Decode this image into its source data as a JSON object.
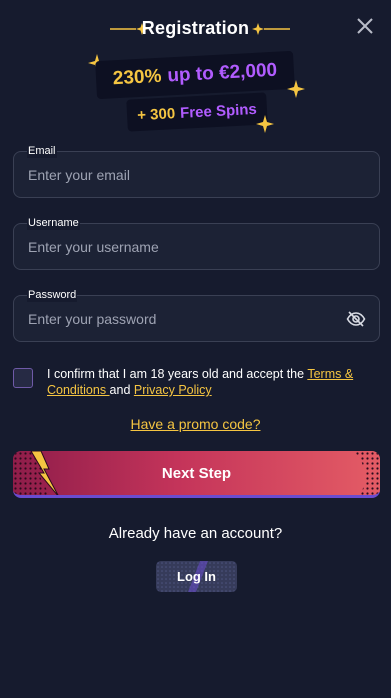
{
  "header": {
    "title": "Registration",
    "close_icon": "close-icon"
  },
  "promo": {
    "main_percent": "230%",
    "main_rest": "up to €2,000",
    "sub_count": "+ 300",
    "sub_rest": "Free Spins"
  },
  "form": {
    "email": {
      "label": "Email",
      "placeholder": "Enter your email",
      "value": ""
    },
    "username": {
      "label": "Username",
      "placeholder": "Enter your username",
      "value": ""
    },
    "password": {
      "label": "Password",
      "placeholder": "Enter your password",
      "value": "",
      "toggle_icon": "eye-off-icon"
    }
  },
  "consent": {
    "checked": false,
    "text_before": "I confirm that I am 18 years old and accept the ",
    "terms_link": "Terms & Conditions ",
    "text_middle": "and ",
    "privacy_link": "Privacy Policy"
  },
  "promo_code_link": "Have a promo code?",
  "next_button": "Next Step",
  "account_prompt": "Already have an account?",
  "login_button": "Log In",
  "colors": {
    "background": "#161b2e",
    "accent_yellow": "#f5c542",
    "accent_purple": "#b15cff",
    "button_gradient_start": "#8f1d4a",
    "button_gradient_end": "#e45c65"
  }
}
